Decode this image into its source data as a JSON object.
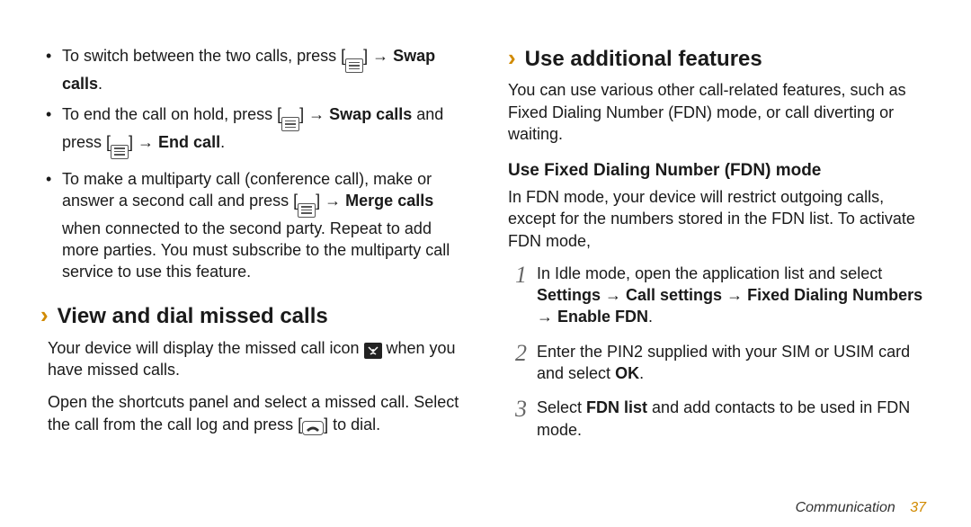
{
  "left": {
    "bullets": [
      {
        "t1": "To switch between the two calls, press [",
        "t2": "] → ",
        "b1": "Swap calls",
        "t3": "."
      },
      {
        "t1": "To end the call on hold, press [",
        "t2": "] → ",
        "b1": "Swap calls",
        "t3": " and press [",
        "t4": "] → ",
        "b2": "End call",
        "t5": "."
      },
      {
        "t1": "To make a multiparty call (conference call), make or answer a second call and press [",
        "t2": "] → ",
        "b1": "Merge calls",
        "t3": " when connected to the second party. Repeat to add more parties. You must subscribe to the multiparty call service to use this feature."
      }
    ],
    "heading": "View and dial missed calls",
    "p1a": "Your device will display the missed call icon ",
    "p1b": " when you have missed calls.",
    "p2a": "Open the shortcuts panel and select a missed call. Select the call from the call log and press [",
    "p2b": "] to dial."
  },
  "right": {
    "heading": "Use additional features",
    "intro": "You can use various other call-related features, such as Fixed Dialing Number (FDN) mode, or call diverting or waiting.",
    "sub": "Use Fixed Dialing Number (FDN) mode",
    "subintro": "In FDN mode, your device will restrict outgoing calls, except for the numbers stored in the FDN list. To activate FDN mode,",
    "steps": [
      {
        "n": "1",
        "t1": "In Idle mode, open the application list and select ",
        "b1": "Settings",
        "arr1": " → ",
        "b2": "Call settings",
        "arr2": " → ",
        "b3": "Fixed Dialing Numbers",
        "arr3": " → ",
        "b4": "Enable FDN",
        "t2": "."
      },
      {
        "n": "2",
        "t1": "Enter the PIN2 supplied with your SIM or USIM card and select ",
        "b1": "OK",
        "t2": "."
      },
      {
        "n": "3",
        "t1": "Select ",
        "b1": "FDN list",
        "t2": " and add contacts to be used in FDN mode."
      }
    ]
  },
  "footer": {
    "section": "Communication",
    "page": "37"
  }
}
